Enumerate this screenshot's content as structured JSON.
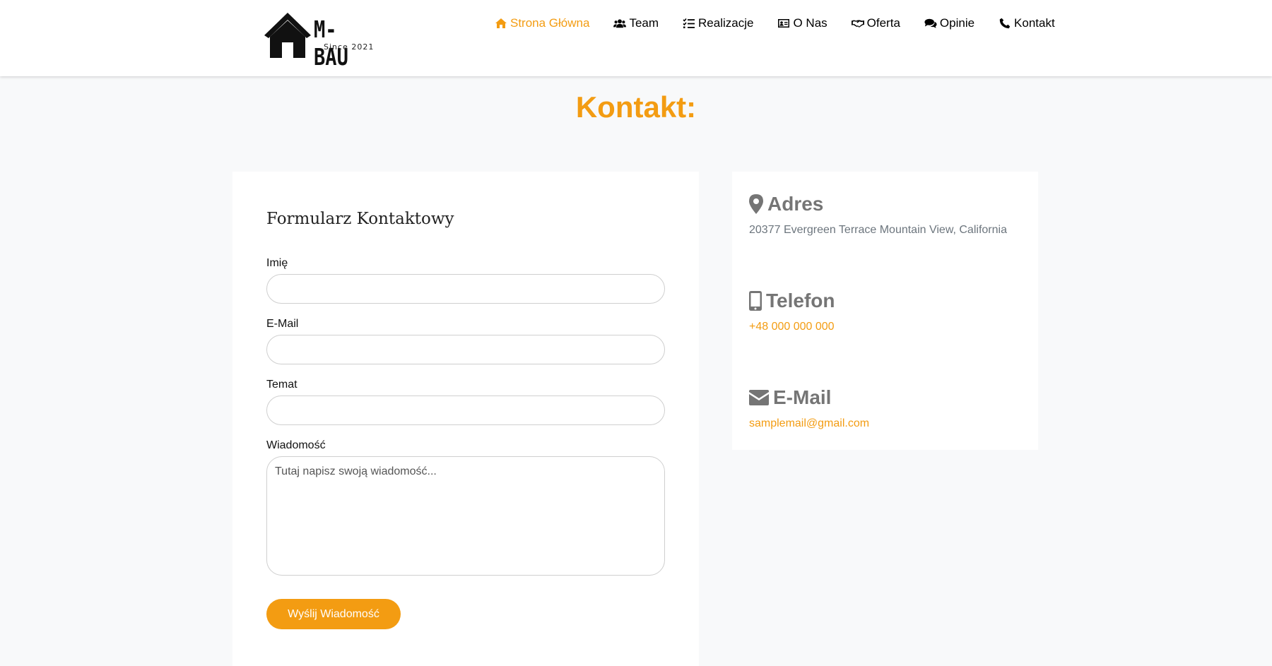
{
  "logo": {
    "name": "M-BAU",
    "tagline": "Since 2021"
  },
  "nav": {
    "items": [
      {
        "label": "Strona Główna",
        "icon": "home-icon"
      },
      {
        "label": "Team",
        "icon": "users-icon"
      },
      {
        "label": "Realizacje",
        "icon": "tasks-icon"
      },
      {
        "label": "O Nas",
        "icon": "id-card-icon"
      },
      {
        "label": "Oferta",
        "icon": "handshake-icon"
      },
      {
        "label": "Opinie",
        "icon": "comments-icon"
      },
      {
        "label": "Kontakt",
        "icon": "phone-icon"
      }
    ],
    "active_index": 0
  },
  "page": {
    "title": "Kontakt:"
  },
  "form": {
    "title": "Formularz Kontaktowy",
    "fields": [
      {
        "label": "Imię",
        "value": ""
      },
      {
        "label": "E-Mail",
        "value": ""
      },
      {
        "label": "Temat",
        "value": ""
      }
    ],
    "message": {
      "label": "Wiadomość",
      "placeholder": "Tutaj napisz swoją wiadomość...",
      "value": ""
    },
    "submit_label": "Wyślij Wiadomość"
  },
  "contact": {
    "address": {
      "heading": "Adres",
      "icon": "map-marker-icon",
      "value": "20377 Evergreen Terrace Mountain View, California"
    },
    "phone": {
      "heading": "Telefon",
      "icon": "mobile-phone-icon",
      "value": "+48 000 000 000"
    },
    "email": {
      "heading": "E-Mail",
      "icon": "envelope-icon",
      "value": "samplemail@gmail.com"
    }
  },
  "colors": {
    "accent": "#f39c12",
    "page_background": "#f8f9fa",
    "heading_gray": "#757575",
    "text_gray": "#6c757d"
  }
}
